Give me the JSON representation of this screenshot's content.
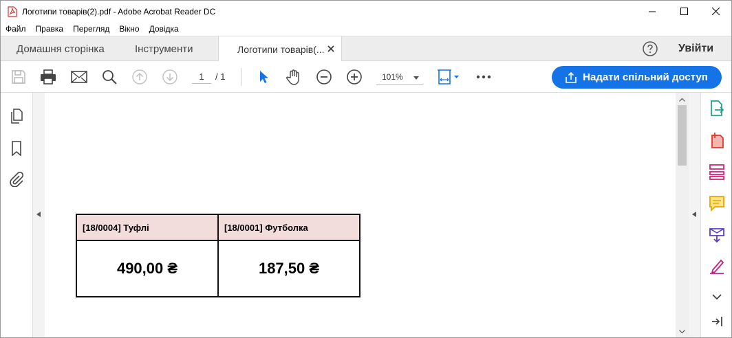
{
  "window": {
    "title": "Логотипи товарів(2).pdf - Adobe Acrobat Reader DC",
    "icon": "pdf-file-icon",
    "buttons": [
      "minimize-icon",
      "maximize-icon",
      "close-icon"
    ]
  },
  "menu": {
    "items": [
      "Файл",
      "Правка",
      "Перегляд",
      "Вікно",
      "Довідка"
    ]
  },
  "tabs": {
    "home": "Домашня сторінка",
    "tools": "Інструменти",
    "document": "Логотипи товарів(...",
    "signin": "Увійти",
    "help_icon": "help-icon"
  },
  "toolbar": {
    "page_current": "1",
    "page_total": "/ 1",
    "zoom": "101%",
    "share_label": "Надати спільний доступ",
    "accent_color": "#1473e6"
  },
  "document": {
    "header_fill": "#f2dcdc",
    "products": [
      {
        "name": "[18/0004] Туфлі",
        "price": "490,00 ₴"
      },
      {
        "name": "[18/0001] Футболка",
        "price": "187,50 ₴"
      }
    ]
  },
  "right_tools": {
    "icons": [
      "export-pdf-icon",
      "create-pdf-icon",
      "organize-pages-icon",
      "comment-icon",
      "send-for-review-icon",
      "fill-sign-icon",
      "chevron-down-icon",
      "collapse-panel-icon"
    ]
  }
}
